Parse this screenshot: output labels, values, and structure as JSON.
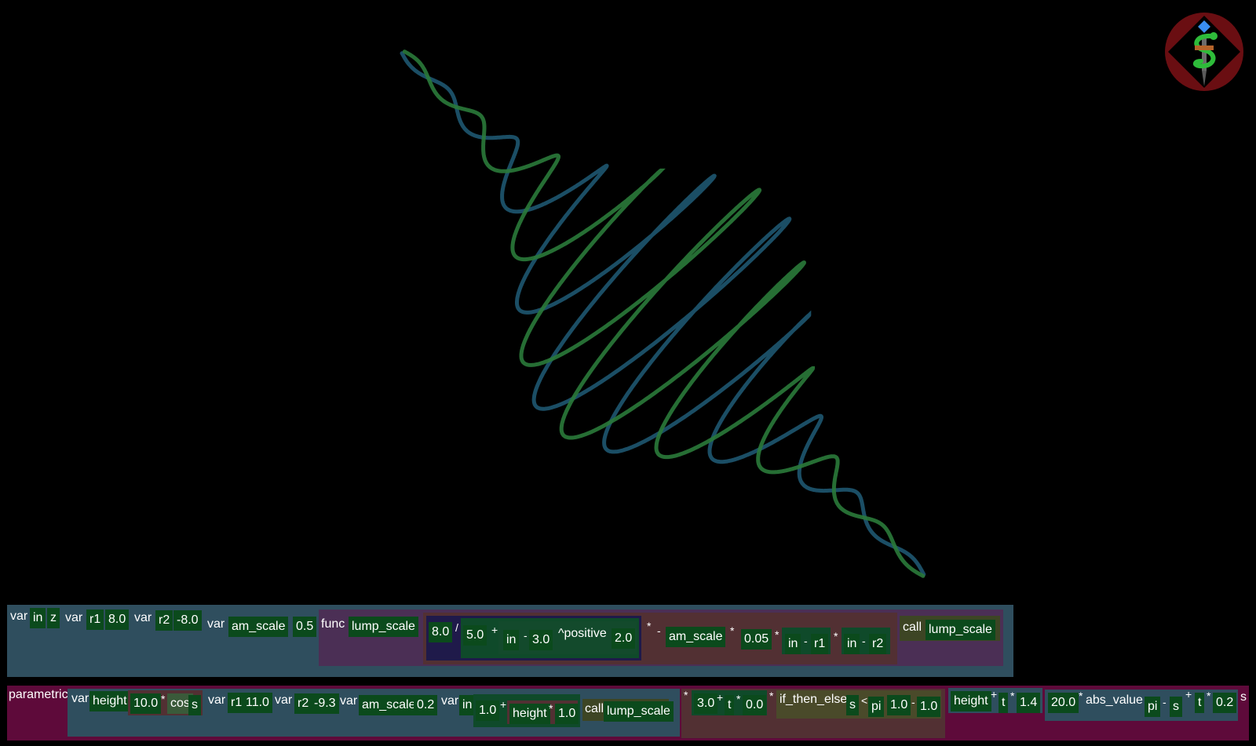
{
  "app": {
    "logo": "snake-caduceus-logo",
    "colors": {
      "background": "#000000",
      "row1_bg": "#2f4e5e",
      "row2_bg": "#5e0a3a",
      "func_bg": "#4b2f55",
      "expr_bg": "#523033",
      "token_bg": "#0b4a1c",
      "curve_blue": "#1e5670",
      "curve_green": "#2a7a3a"
    }
  },
  "row1": {
    "var_kw_1": "var",
    "var_in": "in",
    "var_in_val": "z",
    "var_kw_2": "var",
    "var_r1": "r1",
    "var_r1_val": "8.0",
    "var_kw_3": "var",
    "var_r2": "r2",
    "var_r2_val": "-8.0",
    "var_kw_4": "var",
    "var_am": "am_scale",
    "var_am_val": "0.5",
    "func_kw": "func",
    "func_name": "lump_scale",
    "div_num": "8.0",
    "div_op": "/",
    "plus_left": "5.0",
    "plus_op": "+",
    "pow_in": "in",
    "pow_minus": "-",
    "pow_sub": "3.0",
    "pow_op": "^positive",
    "pow_exp": "2.0",
    "mul_op1": "*",
    "minus_op": "-",
    "am_scale": "am_scale",
    "mul_op2": "*",
    "small": "0.05",
    "mul_op3": "*",
    "p1_in": "in",
    "p1_minus": "-",
    "p1_r": "r1",
    "mul_op4": "*",
    "p2_in": "in",
    "p2_minus": "-",
    "p2_r": "r2",
    "call_kw": "call",
    "call_name": "lump_scale"
  },
  "row2": {
    "parametric_kw": "parametric",
    "var_kw_1": "var",
    "height": "height",
    "height_val": "10.0",
    "mul1": "*",
    "cos": "cos",
    "cos_arg": "s",
    "var_kw_2": "var",
    "r1": "r1",
    "r1_val": "11.0",
    "var_kw_3": "var",
    "r2": "r2",
    "r2_val": "-9.3",
    "var_kw_4": "var",
    "am_scale": "am_scale",
    "am_val": "0.2",
    "var_kw_5": "var",
    "in": "in",
    "in_a": "1.0",
    "in_plus": "+",
    "in_height": "height",
    "in_mul": "*",
    "in_b": "1.0",
    "call_kw": "call",
    "call_name": "lump_scale",
    "mul2": "*",
    "e1_a": "3.0",
    "e1_plus": "+",
    "e1_t": "t",
    "e1_mul": "*",
    "e1_b": "0.0",
    "mul3": "*",
    "ite": "if_then_else",
    "ite_s": "s",
    "ite_lt": "<",
    "ite_pi": "pi",
    "ite_one": "1.0",
    "ite_minus": "-",
    "ite_neg": "1.0",
    "h2": "height",
    "h2_plus": "+",
    "h2_t": "t",
    "h2_mul": "*",
    "h2_val": "1.4",
    "a_val": "20.0",
    "a_mul": "*",
    "abs": "abs_value",
    "abs_pi": "pi",
    "abs_minus": "-",
    "abs_s": "s",
    "plus2": "+",
    "t2": "t",
    "t2_mul": "*",
    "t2_val": "0.2",
    "s_end": "s"
  }
}
